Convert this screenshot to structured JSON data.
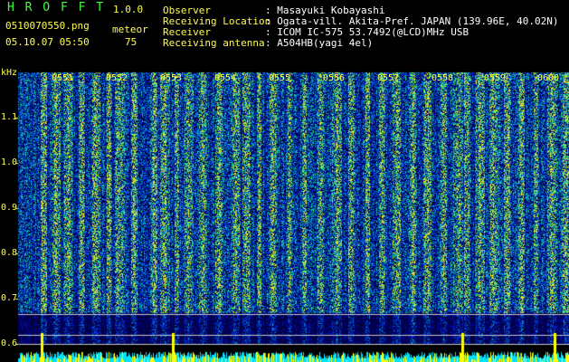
{
  "header": {
    "app_name": "H R O F F T",
    "version": "1.0.0",
    "filename": "0510070550.png",
    "datetime": "05.10.07 05:50",
    "mode_label": "meteor",
    "count": "75",
    "info_labels": [
      "Observer",
      "Receiving Location",
      "Receiver",
      "Receiving antenna"
    ],
    "info_values": [
      ": Masayuki Kobayashi",
      ": Ogata-vill. Akita-Pref. JAPAN (139.96E, 40.02N)",
      ": ICOM IC-575 53.7492(@LCD)MHz USB",
      ": A504HB(yagi 4el)"
    ]
  },
  "spectrogram": {
    "unit_label": "kHz",
    "y_ticks": [
      "1.1",
      "1.0",
      "0.9",
      "0.8",
      "0.7",
      "0.6"
    ],
    "time_ticks": [
      "0551",
      "0552",
      "0553",
      "0554",
      "0555",
      "0556",
      "0557",
      "0558",
      "0559",
      "0600"
    ],
    "colors": {
      "background": "#000000",
      "text_yellow": "#ffff4a",
      "text_green": "#3cff3c",
      "signal_cyan": "#00ffff",
      "bar_yellow": "#ffff00"
    }
  }
}
